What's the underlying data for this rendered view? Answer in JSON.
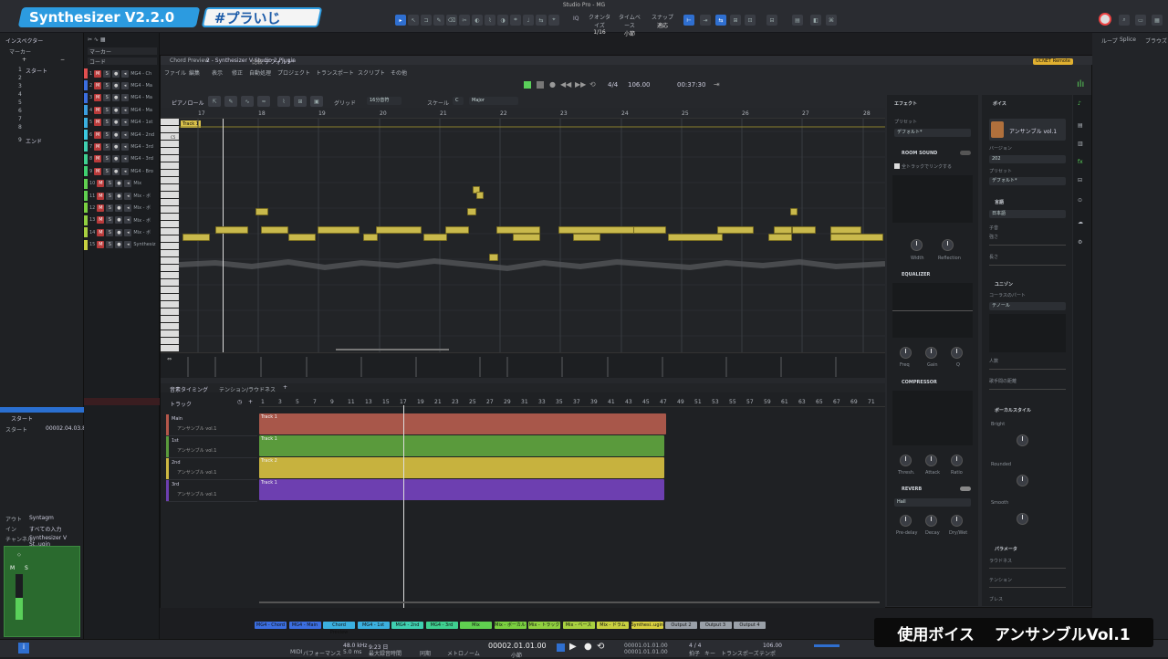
{
  "badges": {
    "title": "Synthesizer V2.2.0",
    "hashtag": "#プラいじ"
  },
  "host": {
    "window_title": "Studio Pro - MG",
    "toolbar": {
      "quantize_label": "クオンタイズ",
      "quantize_value": "1/16",
      "timebase_label": "タイムベース",
      "timebase_value": "小節",
      "snap_label": "スナップ",
      "snap_value": "適応",
      "io_label": "IQ"
    },
    "right_tabs": [
      "ループ",
      "Splice",
      "ブラウズ"
    ],
    "inspector": {
      "title": "インスペクター",
      "marker_label": "マーカー",
      "start": "スタート",
      "end": "エンド",
      "chord_label": "コード"
    },
    "tracks": [
      {
        "n": "1",
        "name": "MG4 - Ch",
        "color": "#e04f4f"
      },
      {
        "n": "2",
        "name": "MG4 - Ma",
        "color": "#3b6ee0"
      },
      {
        "n": "3",
        "name": "MG4 - Ma",
        "color": "#3b6ee0"
      },
      {
        "n": "4",
        "name": "MG4 - Ma",
        "color": "#3b9ee0"
      },
      {
        "n": "5",
        "name": "MG4 - 1st",
        "color": "#3bb0e0"
      },
      {
        "n": "6",
        "name": "MG4 - 2nd",
        "color": "#3bc8e0"
      },
      {
        "n": "7",
        "name": "MG4 - 3rd",
        "color": "#3fd0b0"
      },
      {
        "n": "8",
        "name": "MG4 - 3rd",
        "color": "#3fd090"
      },
      {
        "n": "9",
        "name": "MG4 - Bro",
        "color": "#3fd070"
      },
      {
        "n": "10",
        "name": "Mix",
        "color": "#60d050"
      },
      {
        "n": "11",
        "name": "Mix - ボ",
        "color": "#60d050"
      },
      {
        "n": "12",
        "name": "Mix - ボ",
        "color": "#7ad040"
      },
      {
        "n": "13",
        "name": "Mix - ボ",
        "color": "#90d040"
      },
      {
        "n": "14",
        "name": "Mix - ボ",
        "color": "#a8d040"
      },
      {
        "n": "15",
        "name": "Synthesiz",
        "color": "#c8d040"
      }
    ],
    "left_bottom": {
      "start_label": "スタート",
      "start_value": "00002.04.03.89",
      "out_label": "アウト",
      "out_value": "Syntagm",
      "in_label": "イン",
      "in_value": "すべての入力",
      "channel_label": "チャンネル",
      "channel_value": "Synthesizer V St..ugin"
    },
    "mixer_chips": [
      "MG4 - Chord",
      "MG4 - Main",
      "Chord Preview",
      "MG4 - 1st",
      "MG4 - 2nd",
      "MG4 - 3rd",
      "Mix",
      "Mix - ボーカル",
      "Mix - トラック",
      "Mix - ベース",
      "Mix - ドラム",
      "Synthesi..ugin",
      "Output 2",
      "Output 3",
      "Output 4"
    ],
    "transport": {
      "midi_label": "MIDI",
      "performance_label": "パフォーマンス",
      "sample_rate": "48.0 kHz",
      "latency": "5.0 ms",
      "record_time": "9:23 日",
      "record_label": "最大録音時間",
      "sync_label": "同期",
      "metronome_label": "メトロノーム",
      "position": "00002.01.01.00",
      "position_unit": "小節",
      "loop_start": "00001.01.01.00",
      "loop_end": "00001.01.01.00",
      "signature": "4 / 4",
      "signature_label": "拍子",
      "key_label": "キー",
      "transpose_label": "トランスポーズ",
      "tempo": "106.00",
      "tempo_label": "テンポ"
    }
  },
  "plugin": {
    "chord_preview": "Chord Preview",
    "instance": "2 - Synthesizer V Studio 2 Plugin",
    "preset": "デフォルト*",
    "compare_label": "比較",
    "menu": [
      "ファイル",
      "編集",
      "表示",
      "修正",
      "自動処理",
      "プロジェクト",
      "トランスポート",
      "スクリプト",
      "その他"
    ],
    "ucnet": "UCNET Remote",
    "transport": {
      "time_sig": "4/4",
      "tempo": "106.00",
      "time": "00:37:30"
    },
    "pianoroll": {
      "title": "ピアノロール",
      "grid_label": "グリッド",
      "grid_value": "16分音符",
      "scale_label": "スケール",
      "scale_key": "C",
      "scale_mode": "Major",
      "track_label": "Track 1",
      "bars": [
        "17",
        "18",
        "19",
        "20",
        "21",
        "22",
        "23",
        "24",
        "25",
        "26",
        "27",
        "28"
      ],
      "octave_label": "C5"
    },
    "tabs": {
      "timing": "音素タイミング",
      "tension": "テンション/ラウドネス"
    },
    "tracks_header": "トラック",
    "timeline_bars": [
      "1",
      "3",
      "5",
      "7",
      "9",
      "11",
      "13",
      "15",
      "17",
      "19",
      "21",
      "23",
      "25",
      "27",
      "29",
      "31",
      "33",
      "35",
      "37",
      "39",
      "41",
      "43",
      "45",
      "47",
      "49",
      "51",
      "53",
      "55",
      "57",
      "59",
      "61",
      "63",
      "65",
      "67",
      "69",
      "71"
    ],
    "song_tracks": [
      {
        "name": "Main",
        "voice": "アンサンブル vol.1",
        "clip": "Track 1",
        "color": "#b5574a"
      },
      {
        "name": "1st",
        "voice": "アンサンブル vol.1",
        "clip": "Track 1",
        "color": "#5a9a3c"
      },
      {
        "name": "2nd",
        "voice": "アンサンブル vol.1",
        "clip": "Track 2",
        "color": "#cdb842"
      },
      {
        "name": "3rd",
        "voice": "アンサンブル vol.1",
        "clip": "Track 1",
        "color": "#6d3fb0"
      }
    ],
    "effects": {
      "title": "エフェクト",
      "preset_label": "プリセット",
      "preset_value": "デフォルト*",
      "room_sound": "ROOM SOUND",
      "room_option": "全トラックでリンクする",
      "room_knobs": [
        "Width",
        "Reflection"
      ],
      "equalizer": "EQUALIZER",
      "eq_knobs": [
        "Freq",
        "Gain",
        "Q"
      ],
      "compressor": "COMPRESSOR",
      "comp_knobs": [
        "Thresh.",
        "Attack",
        "Ratio"
      ],
      "reverb": "REVERB",
      "reverb_type": "Hall",
      "reverb_knobs": [
        "Pre-delay",
        "Decay",
        "Dry/Wet"
      ]
    },
    "voice": {
      "title": "ボイス",
      "voice_name": "アンサンブル vol.1",
      "version_label": "バージョン",
      "version_value": "202",
      "preset_label": "プリセット",
      "preset_value": "デフォルト*",
      "language_section": "言語",
      "language_value": "日本語",
      "consonant_label": "子音",
      "strength_label": "強さ",
      "length_label": "長さ",
      "unison_section": "ユニゾン",
      "chorus_label": "コーラスのパート",
      "chorus_value": "テノール",
      "people_label": "人数",
      "distance_label": "歌手間の距離",
      "vocal_style_section": "ボーカルスタイル",
      "styles": [
        "Bright",
        "Rounded",
        "Smooth"
      ],
      "params_section": "パラメータ",
      "params": [
        "ラウドネス",
        "テンション",
        "ブレス"
      ]
    }
  },
  "caption": {
    "label": "使用ボイス",
    "value": "アンサンブルVol.1"
  }
}
